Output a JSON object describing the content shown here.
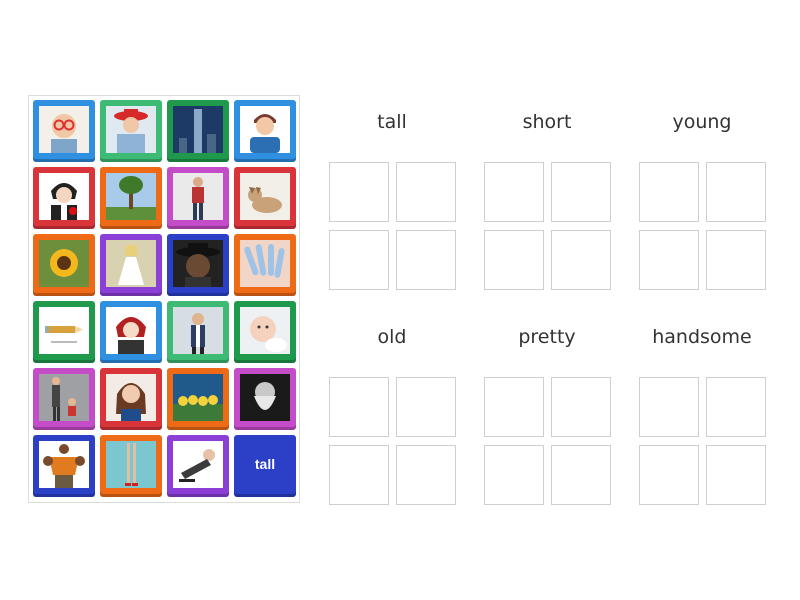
{
  "tiles": [
    {
      "kind": "image",
      "color": "#2f8fe0",
      "icon": "child-with-glasses-image"
    },
    {
      "kind": "image",
      "color": "#3dbb74",
      "icon": "girl-red-hat-image"
    },
    {
      "kind": "image",
      "color": "#1f9a4c",
      "icon": "skyscraper-image"
    },
    {
      "kind": "image",
      "color": "#2f8fe0",
      "icon": "cartoon-man-image"
    },
    {
      "kind": "image",
      "color": "#d9343a",
      "icon": "anime-boy-rose-image"
    },
    {
      "kind": "image",
      "color": "#ef6a16",
      "icon": "tall-tree-image"
    },
    {
      "kind": "image",
      "color": "#c44cc9",
      "icon": "tall-man-standing-image"
    },
    {
      "kind": "image",
      "color": "#d9343a",
      "icon": "puppy-image"
    },
    {
      "kind": "image",
      "color": "#ef6a16",
      "icon": "sunflower-image"
    },
    {
      "kind": "image",
      "color": "#8b3fd6",
      "icon": "girl-white-dress-image"
    },
    {
      "kind": "image",
      "color": "#2b3fc7",
      "icon": "old-man-hat-image"
    },
    {
      "kind": "image",
      "color": "#ef6a16",
      "icon": "nails-image"
    },
    {
      "kind": "image",
      "color": "#1f9a4c",
      "icon": "short-pencil-image"
    },
    {
      "kind": "image",
      "color": "#2f8fe0",
      "icon": "anime-boy-red-hair-image"
    },
    {
      "kind": "image",
      "color": "#3dbb74",
      "icon": "businessman-image"
    },
    {
      "kind": "image",
      "color": "#1f9a4c",
      "icon": "baby-image"
    },
    {
      "kind": "image",
      "color": "#c44cc9",
      "icon": "tall-and-short-figures-image"
    },
    {
      "kind": "image",
      "color": "#d9343a",
      "icon": "pretty-woman-image"
    },
    {
      "kind": "image",
      "color": "#ef6a16",
      "icon": "ducklings-image"
    },
    {
      "kind": "image",
      "color": "#c44cc9",
      "icon": "old-bearded-man-image"
    },
    {
      "kind": "image",
      "color": "#2b3fc7",
      "icon": "strong-man-image"
    },
    {
      "kind": "image",
      "color": "#ef6a16",
      "icon": "tall-legs-image"
    },
    {
      "kind": "image",
      "color": "#8b3fd6",
      "icon": "old-man-falling-image"
    },
    {
      "kind": "word",
      "color": "#2b3fc7",
      "label": "tall"
    }
  ],
  "categories": [
    {
      "title": "tall"
    },
    {
      "title": "short"
    },
    {
      "title": "young"
    },
    {
      "title": "old"
    },
    {
      "title": "pretty"
    },
    {
      "title": "handsome"
    }
  ]
}
